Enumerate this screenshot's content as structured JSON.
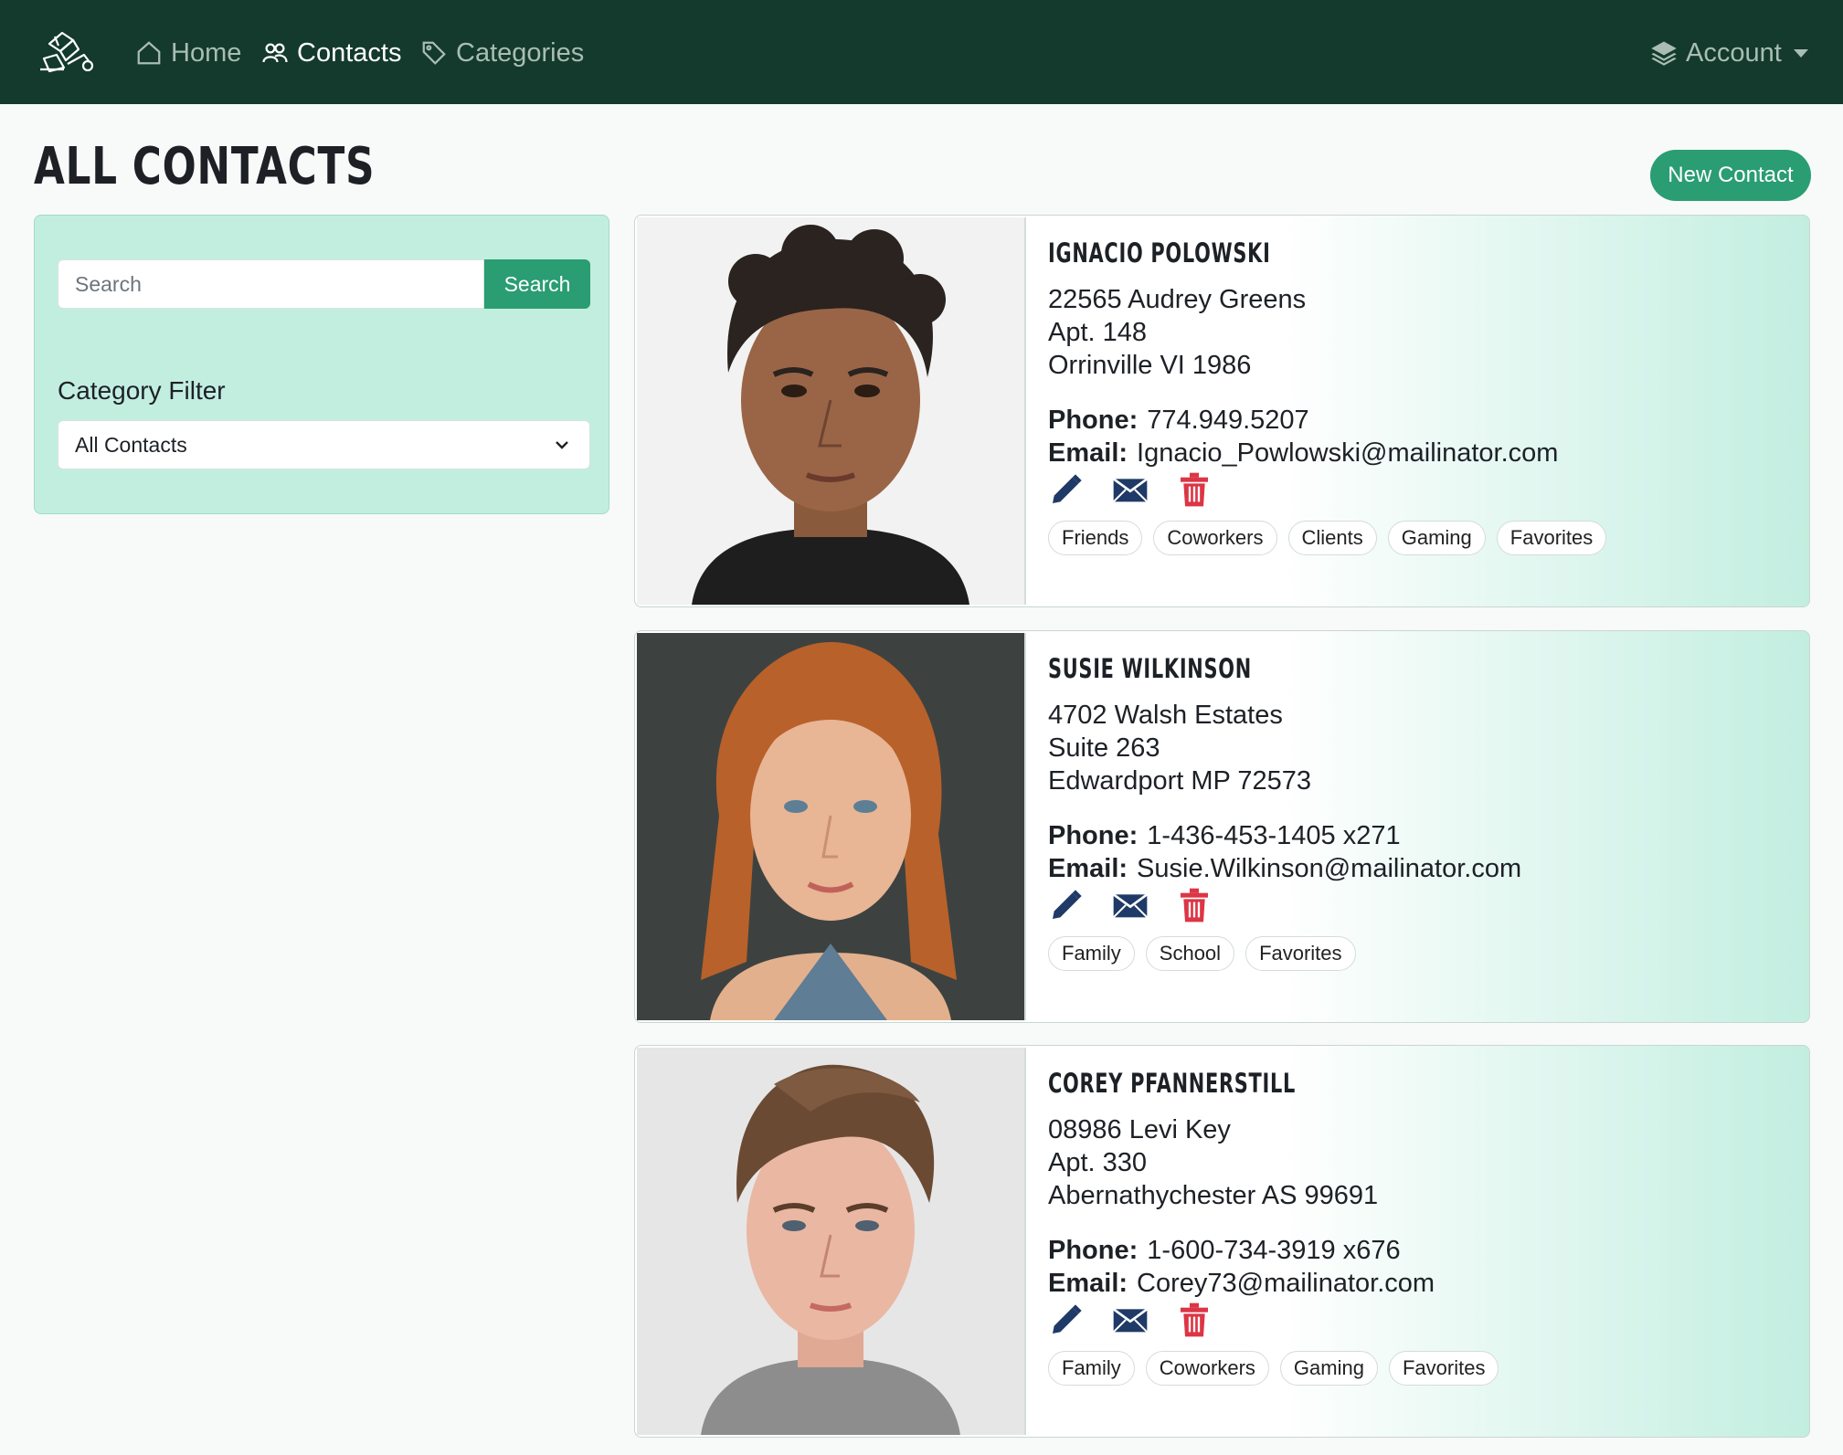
{
  "nav": {
    "home": "Home",
    "contacts": "Contacts",
    "categories": "Categories",
    "account": "Account"
  },
  "header": {
    "title": "ALL CONTACTS",
    "new_contact": "New Contact"
  },
  "sidebar": {
    "search_placeholder": "Search",
    "search_button": "Search",
    "filter_label": "Category Filter",
    "filter_selected": "All Contacts"
  },
  "contacts": [
    {
      "name": "IGNACIO POLOWSKI",
      "address1": "22565 Audrey Greens",
      "address2": "Apt. 148",
      "address3": "Orrinville VI 1986",
      "phone_label": "Phone:",
      "phone": "774.949.5207",
      "email_label": "Email:",
      "email": "Ignacio_Powlowski@mailinator.com",
      "tags": [
        "Friends",
        "Coworkers",
        "Clients",
        "Gaming",
        "Favorites"
      ]
    },
    {
      "name": "SUSIE WILKINSON",
      "address1": "4702 Walsh Estates",
      "address2": "Suite 263",
      "address3": "Edwardport MP 72573",
      "phone_label": "Phone:",
      "phone": "1-436-453-1405 x271",
      "email_label": "Email:",
      "email": "Susie.Wilkinson@mailinator.com",
      "tags": [
        "Family",
        "School",
        "Favorites"
      ]
    },
    {
      "name": "COREY PFANNERSTILL",
      "address1": "08986 Levi Key",
      "address2": "Apt. 330",
      "address3": "Abernathychester AS 99691",
      "phone_label": "Phone:",
      "phone": "1-600-734-3919 x676",
      "email_label": "Email:",
      "email": "Corey73@mailinator.com",
      "tags": [
        "Family",
        "Coworkers",
        "Gaming",
        "Favorites"
      ]
    }
  ],
  "colors": {
    "navbar": "#133a2c",
    "accent": "#2a9d72",
    "sidebar_bg": "#c2eee0",
    "action_icon": "#1f3a66",
    "delete_icon": "#dc3545"
  }
}
